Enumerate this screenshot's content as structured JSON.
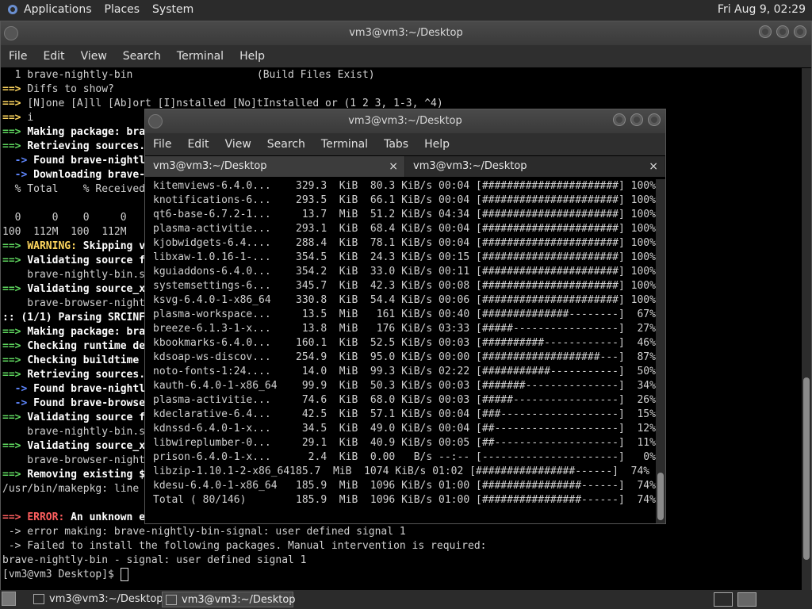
{
  "top_panel": {
    "menus": [
      "Applications",
      "Places",
      "System"
    ],
    "clock": "Fri Aug  9, 02:29"
  },
  "back_window": {
    "title": "vm3@vm3:~/Desktop",
    "menu": [
      "File",
      "Edit",
      "View",
      "Search",
      "Terminal",
      "Help"
    ],
    "lines": [
      [
        {
          "t": "  1 brave-nightly-bin                    (Build Files Exist)",
          "c": ""
        }
      ],
      [
        {
          "t": "==> ",
          "c": "y"
        },
        {
          "t": "Diffs to show?",
          "c": ""
        }
      ],
      [
        {
          "t": "==> ",
          "c": "y"
        },
        {
          "t": "[N]one [A]ll [Ab]ort [I]nstalled [No]tInstalled or (1 2 3, 1-3, ^4)",
          "c": ""
        }
      ],
      [
        {
          "t": "==> ",
          "c": "y"
        },
        {
          "t": "i",
          "c": ""
        }
      ],
      [
        {
          "t": "==> ",
          "c": "g"
        },
        {
          "t": "Making package: bra",
          "c": "b"
        }
      ],
      [
        {
          "t": "==> ",
          "c": "g"
        },
        {
          "t": "Retrieving sources.",
          "c": "b"
        }
      ],
      [
        {
          "t": "  -> ",
          "c": "bl"
        },
        {
          "t": "Found brave-nightl",
          "c": "b"
        }
      ],
      [
        {
          "t": "  -> ",
          "c": "bl"
        },
        {
          "t": "Downloading brave-",
          "c": "b"
        }
      ],
      [
        {
          "t": "  % Total    % Received",
          "c": ""
        }
      ],
      [
        {
          "t": "",
          "c": ""
        }
      ],
      [
        {
          "t": "  0     0    0     0",
          "c": ""
        }
      ],
      [
        {
          "t": "100  112M  100  112M",
          "c": ""
        }
      ],
      [
        {
          "t": "==> ",
          "c": "g"
        },
        {
          "t": "WARNING: ",
          "c": "y"
        },
        {
          "t": "Skipping v",
          "c": "b"
        }
      ],
      [
        {
          "t": "==> ",
          "c": "g"
        },
        {
          "t": "Validating source f",
          "c": "b"
        }
      ],
      [
        {
          "t": "    brave-nightly-bin.s",
          "c": ""
        }
      ],
      [
        {
          "t": "==> ",
          "c": "g"
        },
        {
          "t": "Validating source_x",
          "c": "b"
        }
      ],
      [
        {
          "t": "    brave-browser-night",
          "c": ""
        }
      ],
      [
        {
          "t": ":: (1/1) Parsing SRCINF",
          "c": "b"
        }
      ],
      [
        {
          "t": "==> ",
          "c": "g"
        },
        {
          "t": "Making package: bra",
          "c": "b"
        }
      ],
      [
        {
          "t": "==> ",
          "c": "g"
        },
        {
          "t": "Checking runtime de",
          "c": "b"
        }
      ],
      [
        {
          "t": "==> ",
          "c": "g"
        },
        {
          "t": "Checking buildtime ",
          "c": "b"
        }
      ],
      [
        {
          "t": "==> ",
          "c": "g"
        },
        {
          "t": "Retrieving sources.",
          "c": "b"
        }
      ],
      [
        {
          "t": "  -> ",
          "c": "bl"
        },
        {
          "t": "Found brave-nightl",
          "c": "b"
        }
      ],
      [
        {
          "t": "  -> ",
          "c": "bl"
        },
        {
          "t": "Found brave-browse",
          "c": "b"
        }
      ],
      [
        {
          "t": "==> ",
          "c": "g"
        },
        {
          "t": "Validating source f",
          "c": "b"
        }
      ],
      [
        {
          "t": "    brave-nightly-bin.s",
          "c": ""
        }
      ],
      [
        {
          "t": "==> ",
          "c": "g"
        },
        {
          "t": "Validating source_x",
          "c": "b"
        }
      ],
      [
        {
          "t": "    brave-browser-night",
          "c": ""
        }
      ],
      [
        {
          "t": "==> ",
          "c": "g"
        },
        {
          "t": "Removing existing $",
          "c": "b"
        }
      ],
      [
        {
          "t": "/usr/bin/makepkg: line ",
          "c": ""
        }
      ],
      [
        {
          "t": "",
          "c": ""
        }
      ],
      [
        {
          "t": "==> ",
          "c": "r"
        },
        {
          "t": "ERROR: ",
          "c": "r"
        },
        {
          "t": "An unknown e",
          "c": "b"
        }
      ],
      [
        {
          "t": " -> error making: brave-nightly-bin-signal: user defined signal 1",
          "c": ""
        }
      ],
      [
        {
          "t": " -> Failed to install the following packages. Manual intervention is required:",
          "c": ""
        }
      ],
      [
        {
          "t": "brave-nightly-bin - signal: user defined signal 1",
          "c": ""
        }
      ],
      [
        {
          "t": "[vm3@vm3 Desktop]$ ",
          "c": ""
        }
      ]
    ]
  },
  "front_window": {
    "title": "vm3@vm3:~/Desktop",
    "menu": [
      "File",
      "Edit",
      "View",
      "Search",
      "Terminal",
      "Tabs",
      "Help"
    ],
    "tabs": [
      {
        "label": "vm3@vm3:~/Desktop",
        "active": true
      },
      {
        "label": "vm3@vm3:~/Desktop",
        "active": false
      }
    ],
    "tab_close": "×",
    "lines": [
      "kitemviews-6.4.0...    329.3  KiB  80.3 KiB/s 00:04 [######################] 100%",
      "knotifications-6...    293.5  KiB  66.1 KiB/s 00:04 [######################] 100%",
      "qt6-base-6.7.2-1...     13.7  MiB  51.2 KiB/s 04:34 [######################] 100%",
      "plasma-activitie...    293.1  KiB  68.4 KiB/s 00:04 [######################] 100%",
      "kjobwidgets-6.4....    288.4  KiB  78.1 KiB/s 00:04 [######################] 100%",
      "libxaw-1.0.16-1-...    354.5  KiB  24.3 KiB/s 00:15 [######################] 100%",
      "kguiaddons-6.4.0...    354.2  KiB  33.0 KiB/s 00:11 [######################] 100%",
      "systemsettings-6...    345.7  KiB  42.3 KiB/s 00:08 [######################] 100%",
      "ksvg-6.4.0-1-x86_64    330.8  KiB  54.4 KiB/s 00:06 [######################] 100%",
      "plasma-workspace...     13.5  MiB   161 KiB/s 00:40 [##############--------]  67%",
      "breeze-6.1.3-1-x...     13.8  MiB   176 KiB/s 03:33 [#####-----------------]  27%",
      "kbookmarks-6.4.0...    160.1  KiB  52.5 KiB/s 00:03 [##########------------]  46%",
      "kdsoap-ws-discov...    254.9  KiB  95.0 KiB/s 00:00 [###################---]  87%",
      "noto-fonts-1:24....     14.0  MiB  99.3 KiB/s 02:22 [###########-----------]  50%",
      "kauth-6.4.0-1-x86_64    99.9  KiB  50.3 KiB/s 00:03 [#######---------------]  34%",
      "plasma-activitie...     74.6  KiB  68.0 KiB/s 00:03 [#####-----------------]  26%",
      "kdeclarative-6.4...     42.5  KiB  57.1 KiB/s 00:04 [###-------------------]  15%",
      "kdnssd-6.4.0-1-x...     34.5  KiB  49.0 KiB/s 00:04 [##--------------------]  12%",
      "libwireplumber-0...     29.1  KiB  40.9 KiB/s 00:05 [##--------------------]  11%",
      "prison-6.4.0-1-x...      2.4  KiB  0.00   B/s --:-- [----------------------]   0%",
      "libzip-1.10.1-2-x86_64185.7  MiB  1074 KiB/s 01:02 [################------]  74%",
      "kdesu-6.4.0-1-x86_64   185.9  MiB  1096 KiB/s 01:00 [################------]  74%",
      "Total ( 80/146)        185.9  MiB  1096 KiB/s 01:00 [################------]  74%"
    ]
  },
  "taskbar": {
    "tasks": [
      {
        "label": "vm3@vm3:~/Desktop",
        "active": false
      },
      {
        "label": "vm3@vm3:~/Desktop",
        "active": true
      }
    ]
  }
}
